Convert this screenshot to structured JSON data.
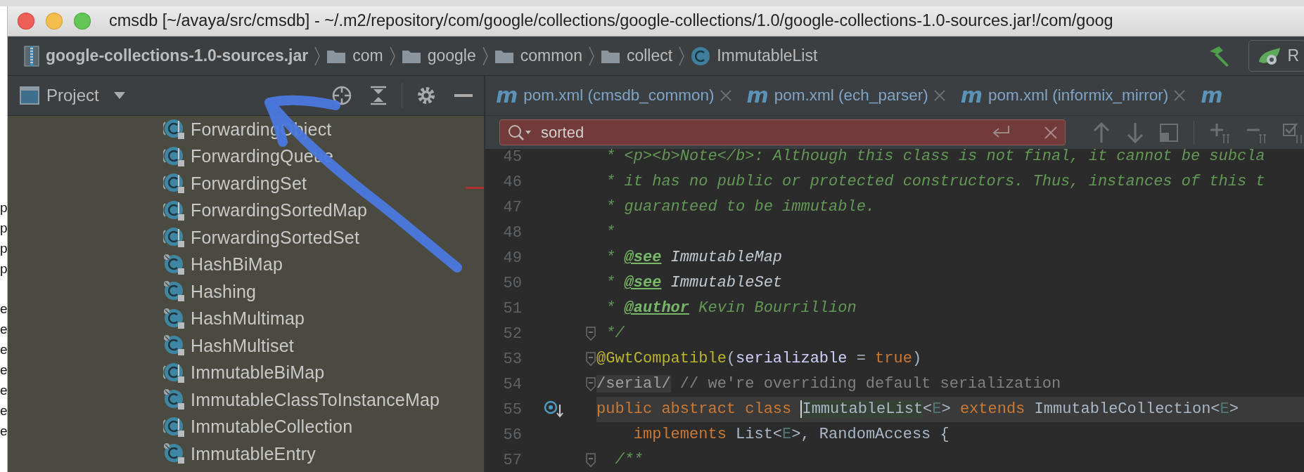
{
  "behind_window": {
    "groups": [
      [
        "p",
        "p",
        "p",
        "p"
      ],
      [
        "e",
        "e",
        "e",
        "e",
        "e",
        "e",
        "e"
      ]
    ]
  },
  "window": {
    "title": "cmsdb [~/avaya/src/cmsdb] - ~/.m2/repository/com/google/collections/google-collections/1.0/google-collections-1.0-sources.jar!/com/goog"
  },
  "breadcrumbs": [
    {
      "kind": "jar",
      "label": "google-collections-1.0-sources.jar"
    },
    {
      "kind": "folder",
      "label": "com"
    },
    {
      "kind": "folder",
      "label": "google"
    },
    {
      "kind": "folder",
      "label": "common"
    },
    {
      "kind": "folder",
      "label": "collect"
    },
    {
      "kind": "class",
      "label": "ImmutableList"
    }
  ],
  "toolbar": {
    "run_button": {
      "label": "R"
    }
  },
  "project_panel": {
    "title": "Project",
    "items": [
      {
        "kind": "abstract",
        "label": "ForwardingObject"
      },
      {
        "kind": "abstract",
        "label": "ForwardingQueue"
      },
      {
        "kind": "abstract",
        "label": "ForwardingSet"
      },
      {
        "kind": "abstract",
        "label": "ForwardingSortedMap"
      },
      {
        "kind": "abstract",
        "label": "ForwardingSortedSet"
      },
      {
        "kind": "final",
        "label": "HashBiMap"
      },
      {
        "kind": "final",
        "label": "Hashing"
      },
      {
        "kind": "final",
        "label": "HashMultimap"
      },
      {
        "kind": "final",
        "label": "HashMultiset"
      },
      {
        "kind": "abstract",
        "label": "ImmutableBiMap"
      },
      {
        "kind": "final",
        "label": "ImmutableClassToInstanceMap"
      },
      {
        "kind": "abstract",
        "label": "ImmutableCollection"
      },
      {
        "kind": "final",
        "label": "ImmutableEntry"
      }
    ]
  },
  "editor": {
    "tabs": [
      {
        "icon": "m",
        "label": "pom.xml (cmsdb_common)"
      },
      {
        "icon": "m",
        "label": "pom.xml (ech_parser)"
      },
      {
        "icon": "m",
        "label": "pom.xml (informix_mirror)"
      },
      {
        "icon": "m"
      }
    ],
    "search": {
      "value": "sorted",
      "no_match": true
    },
    "lines": [
      {
        "number": "45",
        "fold": false,
        "current": false,
        "override_marker": false,
        "tokens": [
          {
            "kind": "comment",
            "text": " * <p><b>Note</b>: Although this class is not final, it cannot be subcla"
          }
        ]
      },
      {
        "number": "46",
        "fold": false,
        "current": false,
        "override_marker": false,
        "tokens": [
          {
            "kind": "comment",
            "text": " * it has no public or protected constructors. Thus, instances of this t"
          }
        ]
      },
      {
        "number": "47",
        "fold": false,
        "current": false,
        "override_marker": false,
        "tokens": [
          {
            "kind": "comment",
            "text": " * guaranteed to be immutable."
          }
        ]
      },
      {
        "number": "48",
        "fold": false,
        "current": false,
        "override_marker": false,
        "tokens": [
          {
            "kind": "comment",
            "text": " *"
          }
        ]
      },
      {
        "number": "49",
        "fold": false,
        "current": false,
        "override_marker": false,
        "tokens": [
          {
            "kind": "comment",
            "text": " * "
          },
          {
            "kind": "doctag",
            "text": "@see"
          },
          {
            "kind": "docref",
            "text": " ImmutableMap"
          }
        ]
      },
      {
        "number": "50",
        "fold": false,
        "current": false,
        "override_marker": false,
        "tokens": [
          {
            "kind": "comment",
            "text": " * "
          },
          {
            "kind": "doctag",
            "text": "@see"
          },
          {
            "kind": "docref",
            "text": " ImmutableSet"
          }
        ]
      },
      {
        "number": "51",
        "fold": false,
        "current": false,
        "override_marker": false,
        "tokens": [
          {
            "kind": "comment",
            "text": " * "
          },
          {
            "kind": "doctag",
            "text": "@author"
          },
          {
            "kind": "comment",
            "text": " Kevin Bourrillion"
          }
        ]
      },
      {
        "number": "52",
        "fold": true,
        "current": false,
        "override_marker": false,
        "tokens": [
          {
            "kind": "comment",
            "text": " */"
          }
        ]
      },
      {
        "number": "53",
        "fold": true,
        "current": false,
        "override_marker": false,
        "tokens": [
          {
            "kind": "annotation",
            "text": "@GwtCompatible"
          },
          {
            "kind": "plain",
            "text": "("
          },
          {
            "kind": "param",
            "text": "serializable"
          },
          {
            "kind": "plain",
            "text": " = "
          },
          {
            "kind": "keyword",
            "text": "true"
          },
          {
            "kind": "plain",
            "text": ")"
          }
        ]
      },
      {
        "number": "54",
        "fold": true,
        "current": false,
        "override_marker": false,
        "tokens": [
          {
            "kind": "folded",
            "text": "/serial/"
          },
          {
            "kind": "linecomment",
            "text": " // we're overriding default serialization"
          }
        ]
      },
      {
        "number": "55",
        "fold": false,
        "current": true,
        "override_marker": true,
        "tokens": [
          {
            "kind": "keyword",
            "text": "public abstract class "
          },
          {
            "kind": "caret_word",
            "text": "ImmutableList"
          },
          {
            "kind": "plain",
            "text": "<"
          },
          {
            "kind": "typeparam",
            "text": "E"
          },
          {
            "kind": "plain",
            "text": "> "
          },
          {
            "kind": "keyword",
            "text": "extends "
          },
          {
            "kind": "plain",
            "text": "ImmutableCollection<"
          },
          {
            "kind": "typeparam",
            "text": "E"
          },
          {
            "kind": "plain",
            "text": ">"
          }
        ]
      },
      {
        "number": "56",
        "fold": false,
        "current": false,
        "override_marker": false,
        "tokens": [
          {
            "kind": "keyword",
            "text": "    implements "
          },
          {
            "kind": "plain",
            "text": "List<"
          },
          {
            "kind": "typeparam",
            "text": "E"
          },
          {
            "kind": "plain",
            "text": ">, RandomAccess {"
          }
        ]
      },
      {
        "number": "57",
        "fold": true,
        "current": false,
        "override_marker": false,
        "tokens": [
          {
            "kind": "comment",
            "text": "  /**"
          }
        ]
      }
    ]
  },
  "overlay": {
    "kind": "arrow"
  }
}
